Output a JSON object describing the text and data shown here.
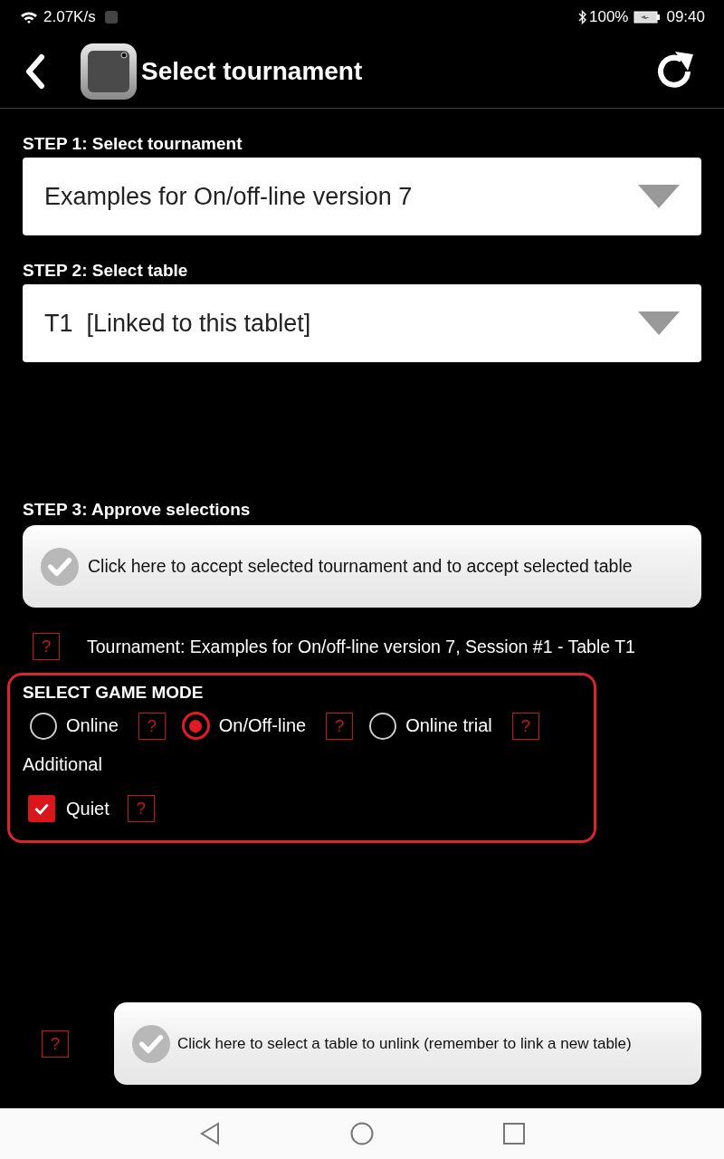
{
  "status_bar": {
    "network_speed": "2.07K/s",
    "battery": "100%",
    "time": "09:40"
  },
  "app_bar": {
    "title": "Select tournament"
  },
  "step1": {
    "label": "STEP 1: Select tournament",
    "value": "Examples for On/off-line version 7"
  },
  "step2": {
    "label": "STEP 2: Select table",
    "value": "T1  [Linked to this tablet]"
  },
  "step3": {
    "label": "STEP 3: Approve selections",
    "button": "Click here to accept selected tournament and to accept selected table"
  },
  "summary": {
    "help": "?",
    "text": "Tournament: Examples for On/off-line version 7, Session #1 - Table T1"
  },
  "game_mode": {
    "title": "SELECT GAME MODE",
    "modes": [
      {
        "label": "Online",
        "selected": false,
        "help": "?"
      },
      {
        "label": "On/Off-line",
        "selected": true,
        "help": "?"
      },
      {
        "label": "Online trial",
        "selected": false,
        "help": "?"
      }
    ],
    "additional_label": "Additional",
    "options": [
      {
        "label": "Quiet",
        "checked": true,
        "help": "?"
      }
    ]
  },
  "unlink": {
    "help": "?",
    "button": "Click here to select a table to unlink (remember to link a new table)"
  }
}
